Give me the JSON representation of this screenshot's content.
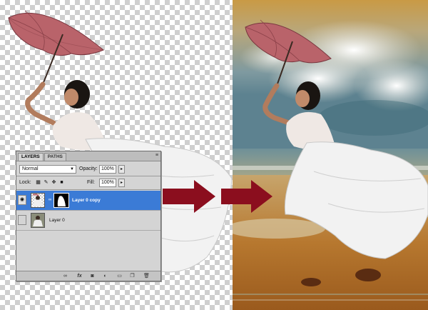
{
  "layers_panel": {
    "tabs": [
      {
        "label": "LAYERS"
      },
      {
        "label": "PATHS"
      }
    ],
    "blend_mode": "Normal",
    "opacity_label": "Opacity:",
    "opacity_value": "100%",
    "lock_label": "Lock:",
    "fill_label": "Fill:",
    "fill_value": "100%",
    "layers": [
      {
        "name": "Layer 0 copy",
        "selected": true,
        "visible": true,
        "has_mask": true
      },
      {
        "name": "Layer 0",
        "selected": false,
        "visible": false,
        "has_mask": false
      }
    ],
    "footer_icons": [
      "link-icon",
      "fx-icon",
      "add-mask-icon",
      "adjustment-icon",
      "group-folder-icon",
      "new-layer-icon",
      "trash-icon"
    ]
  },
  "colors": {
    "selection_blue": "#3b7bd6",
    "arrow_red": "#8b0e1e",
    "umbrella_pink": "#b9636a",
    "dress_white": "#f2f2f2"
  }
}
